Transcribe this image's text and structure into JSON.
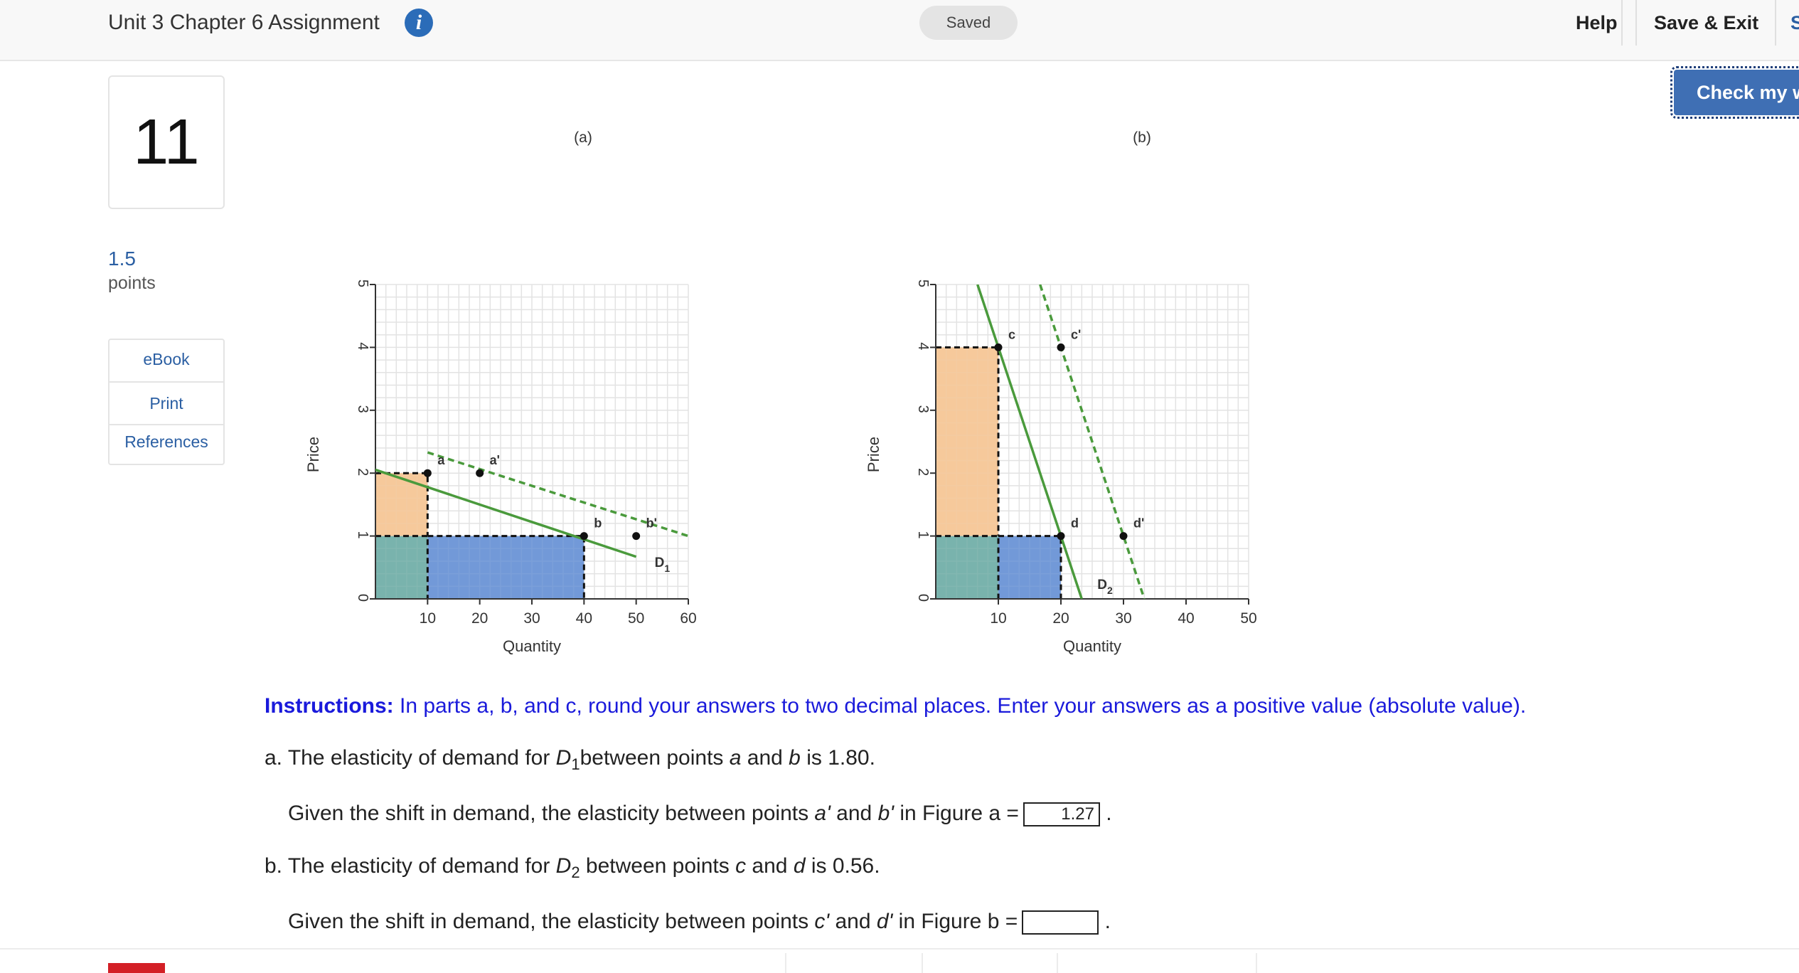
{
  "header": {
    "title": "Unit 3 Chapter 6 Assignment",
    "info_icon": "i",
    "saved": "Saved",
    "help": "Help",
    "save_exit": "Save & Exit",
    "submit_partial": "S",
    "check_work": "Check my w"
  },
  "question": {
    "number": "11",
    "points_value": "1.5",
    "points_label": "points"
  },
  "side_menu": [
    "eBook",
    "Print",
    "References"
  ],
  "chart_data": [
    {
      "type": "line",
      "title": "(a)",
      "xlabel": "Quantity",
      "ylabel": "Price",
      "xlim": [
        0,
        60
      ],
      "ylim": [
        0,
        5
      ],
      "x_ticks": [
        "10",
        "20",
        "30",
        "40",
        "50",
        "60"
      ],
      "y_ticks": [
        "0",
        "1",
        "2",
        "3",
        "4",
        "5"
      ],
      "grid": true,
      "series": [
        {
          "name": "D1",
          "style": "solid",
          "color": "#4a9a3c",
          "x": [
            -10,
            50
          ],
          "y": [
            2.33,
            0.67
          ]
        },
        {
          "style": "dashed",
          "color": "#4a9a3c",
          "x": [
            10,
            60
          ],
          "y": [
            2.33,
            1.0
          ]
        }
      ],
      "points": [
        {
          "label": "a",
          "x": 10,
          "y": 2
        },
        {
          "label": "b",
          "x": 40,
          "y": 1
        },
        {
          "label": "a'",
          "x": 20,
          "y": 2
        },
        {
          "label": "b'",
          "x": 50,
          "y": 1
        }
      ],
      "shaded": [
        {
          "color": "#f5c99b",
          "x": [
            0,
            10
          ],
          "y": [
            1,
            2
          ]
        },
        {
          "color": "#79b3ad",
          "x": [
            0,
            10
          ],
          "y": [
            0,
            1
          ]
        },
        {
          "color": "#7299d8",
          "x": [
            10,
            40
          ],
          "y": [
            0,
            1
          ]
        }
      ]
    },
    {
      "type": "line",
      "title": "(b)",
      "xlabel": "Quantity",
      "ylabel": "Price",
      "xlim": [
        0,
        50
      ],
      "ylim": [
        0,
        5
      ],
      "x_ticks": [
        "10",
        "20",
        "30",
        "40",
        "50"
      ],
      "y_ticks": [
        "0",
        "1",
        "2",
        "3",
        "4",
        "5"
      ],
      "grid": true,
      "series": [
        {
          "name": "D2",
          "style": "solid",
          "color": "#4a9a3c",
          "x": [
            6.67,
            23.33
          ],
          "y": [
            5,
            0
          ]
        },
        {
          "style": "dashed",
          "color": "#4a9a3c",
          "x": [
            16.67,
            33.33
          ],
          "y": [
            5,
            0
          ]
        }
      ],
      "points": [
        {
          "label": "c",
          "x": 10,
          "y": 4
        },
        {
          "label": "d",
          "x": 20,
          "y": 1
        },
        {
          "label": "c'",
          "x": 20,
          "y": 4
        },
        {
          "label": "d'",
          "x": 30,
          "y": 1
        }
      ],
      "shaded": [
        {
          "color": "#f5c99b",
          "x": [
            0,
            10
          ],
          "y": [
            1,
            4
          ]
        },
        {
          "color": "#79b3ad",
          "x": [
            0,
            10
          ],
          "y": [
            0,
            1
          ]
        },
        {
          "color": "#7299d8",
          "x": [
            10,
            20
          ],
          "y": [
            0,
            1
          ]
        }
      ]
    }
  ],
  "text": {
    "instr_bold": "Instructions:",
    "instr_rest": " In parts a, b, and c, round your answers to two decimal places. Enter your answers as a positive value (absolute value).",
    "a_prefix": "a. The elasticity of demand for ",
    "a_D": "D",
    "a_sub": "1",
    "a_mid1": "between points ",
    "a_p1": "a",
    "a_and": " and ",
    "a_p2": "b",
    "a_end": " is 1.80.",
    "a2_prefix": "Given the shift in demand, the elasticity between points ",
    "a2_p1": "a'",
    "a2_and": " and ",
    "a2_p2": "b'",
    "a2_end": " in Figure a =",
    "a2_answer": "1.27",
    "b_prefix": "b. The elasticity of demand for ",
    "b_D": "D",
    "b_sub": "2",
    "b_mid1": " between points ",
    "b_p1": "c",
    "b_and": " and ",
    "b_p2": "d",
    "b_end": " is 0.56.",
    "b2_prefix": "Given the shift in demand, the elasticity between points ",
    "b2_p1": "c'",
    "b2_and": " and ",
    "b2_p2": "d'",
    "b2_end": " in Figure b =",
    "b2_answer": "",
    "period": "."
  }
}
